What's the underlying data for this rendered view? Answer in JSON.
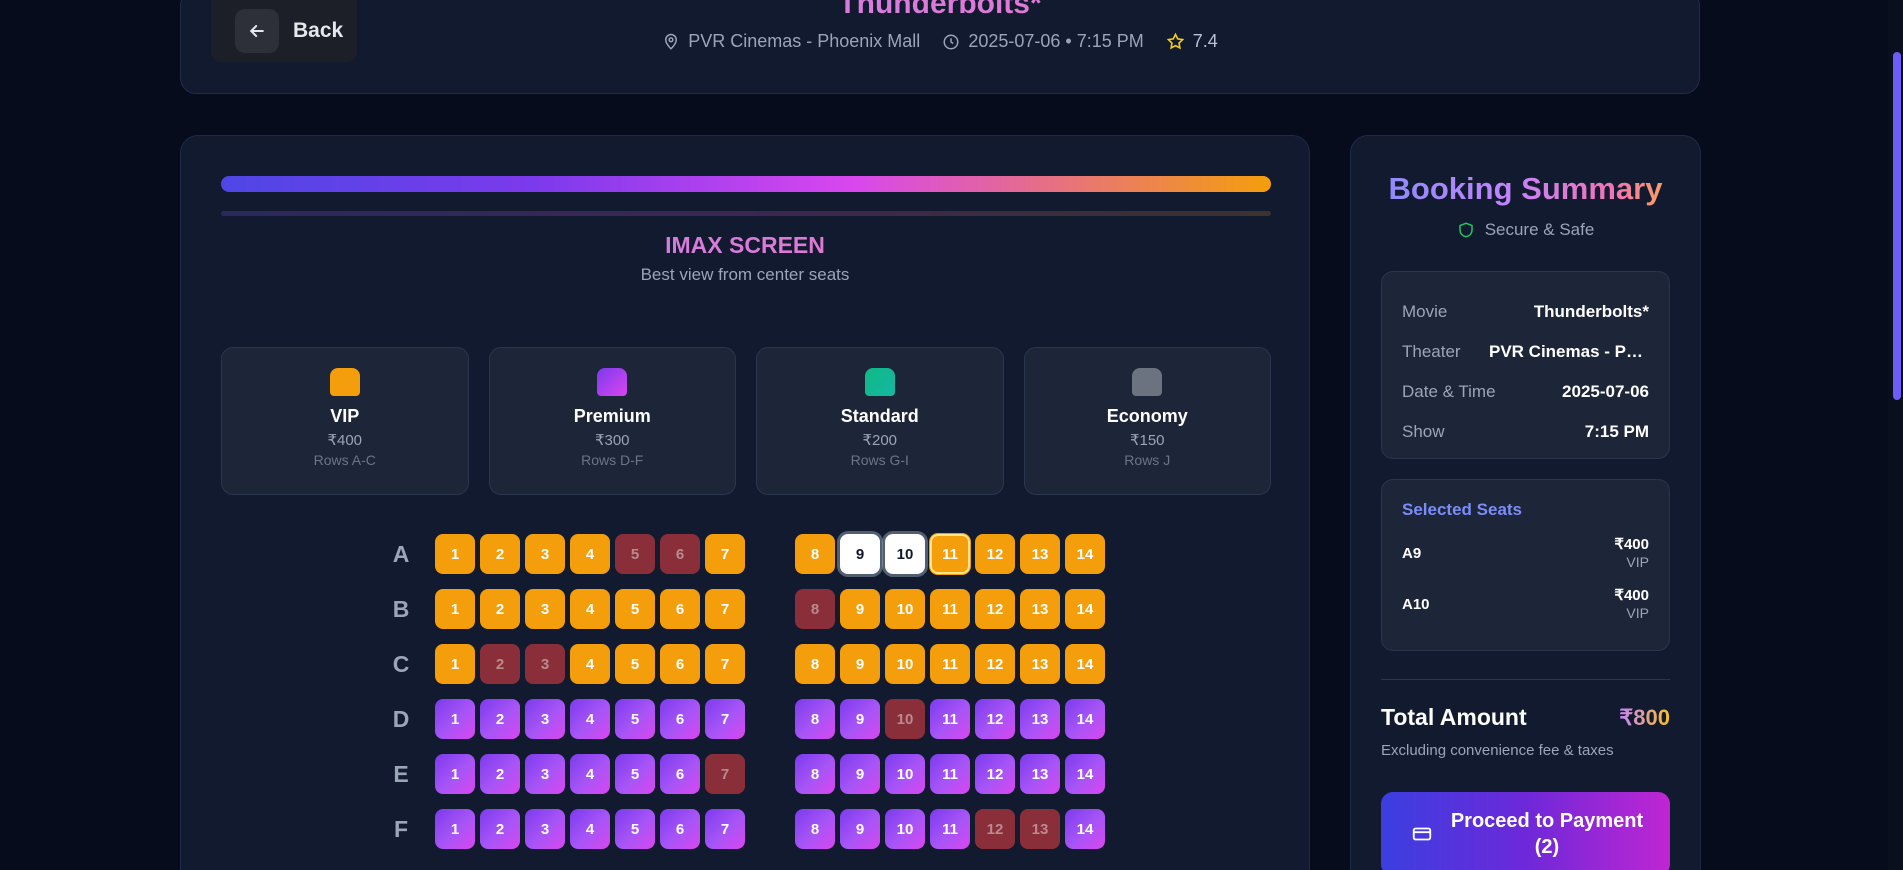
{
  "header": {
    "back_label": "Back",
    "movie_title": "Thunderbolts*",
    "theater": "PVR Cinemas - Phoenix Mall",
    "datetime": "2025-07-06 • 7:15 PM",
    "rating": "7.4"
  },
  "screen": {
    "label": "IMAX SCREEN",
    "subtitle": "Best view from center seats"
  },
  "categories": [
    {
      "name": "VIP",
      "price": "₹400",
      "rows": "Rows A-C",
      "color": "#f59e0b"
    },
    {
      "name": "Premium",
      "price": "₹300",
      "rows": "Rows D-F",
      "color": "#a855f7"
    },
    {
      "name": "Standard",
      "price": "₹200",
      "rows": "Rows G-I",
      "color": "#10b981"
    },
    {
      "name": "Economy",
      "price": "₹150",
      "rows": "Rows J",
      "color": "#6b7280"
    }
  ],
  "seat_rows": [
    {
      "row": "A",
      "cls": "vip",
      "booked": [
        5,
        6
      ],
      "selected": [
        9,
        10
      ],
      "focused": [
        11
      ]
    },
    {
      "row": "B",
      "cls": "vip",
      "booked": [
        8
      ],
      "selected": [],
      "focused": []
    },
    {
      "row": "C",
      "cls": "vip",
      "booked": [
        2,
        3
      ],
      "selected": [],
      "focused": []
    },
    {
      "row": "D",
      "cls": "premium",
      "booked": [
        10
      ],
      "selected": [],
      "focused": []
    },
    {
      "row": "E",
      "cls": "premium",
      "booked": [
        7
      ],
      "selected": [],
      "focused": []
    },
    {
      "row": "F",
      "cls": "premium",
      "booked": [
        12,
        13
      ],
      "selected": [],
      "focused": []
    }
  ],
  "summary": {
    "title": "Booking Summary",
    "secure_label": "Secure & Safe",
    "info": [
      {
        "key": "Movie",
        "value": "Thunderbolts*"
      },
      {
        "key": "Theater",
        "value": "PVR Cinemas - Ph..."
      },
      {
        "key": "Date & Time",
        "value": "2025-07-06"
      },
      {
        "key": "Show",
        "value": "7:15 PM"
      }
    ],
    "selected_heading": "Selected Seats",
    "selected_seats": [
      {
        "id": "A9",
        "price": "₹400",
        "category": "VIP"
      },
      {
        "id": "A10",
        "price": "₹400",
        "category": "VIP"
      }
    ],
    "total_label": "Total Amount",
    "total_value": "₹800",
    "total_note": "Excluding convenience fee & taxes",
    "pay_label": "Proceed to Payment (2)"
  }
}
